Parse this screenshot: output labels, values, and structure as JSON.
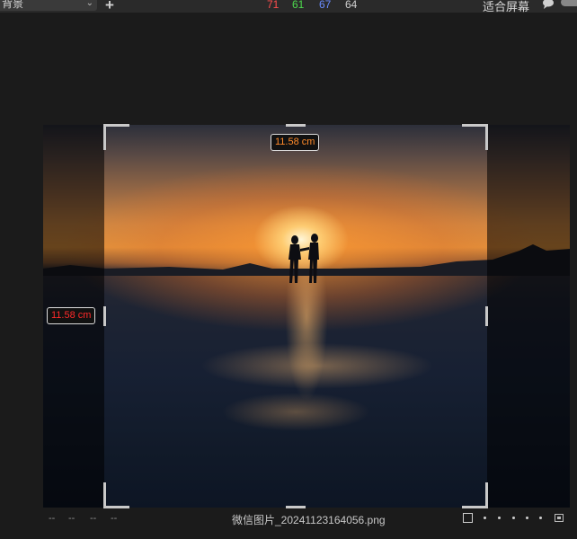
{
  "toolbar": {
    "layer_select": {
      "value": "背景"
    },
    "channels": [
      {
        "value": "71",
        "color": "#ff4d4d"
      },
      {
        "value": "61",
        "color": "#4dd94d"
      },
      {
        "value": "67",
        "color": "#6a8cff"
      },
      {
        "value": "64",
        "color": "#cfcfcf"
      }
    ],
    "fit_screen_label": "适合屏幕"
  },
  "crop": {
    "width_label": "11.58 cm",
    "height_label": "11.58 cm",
    "width_label_color": "#ff8a2a",
    "height_label_color": "#ff2a2a"
  },
  "statusbar": {
    "coords": [
      "--",
      "--",
      "--",
      "--"
    ],
    "filename": "微信图片_20241123164056.png"
  }
}
